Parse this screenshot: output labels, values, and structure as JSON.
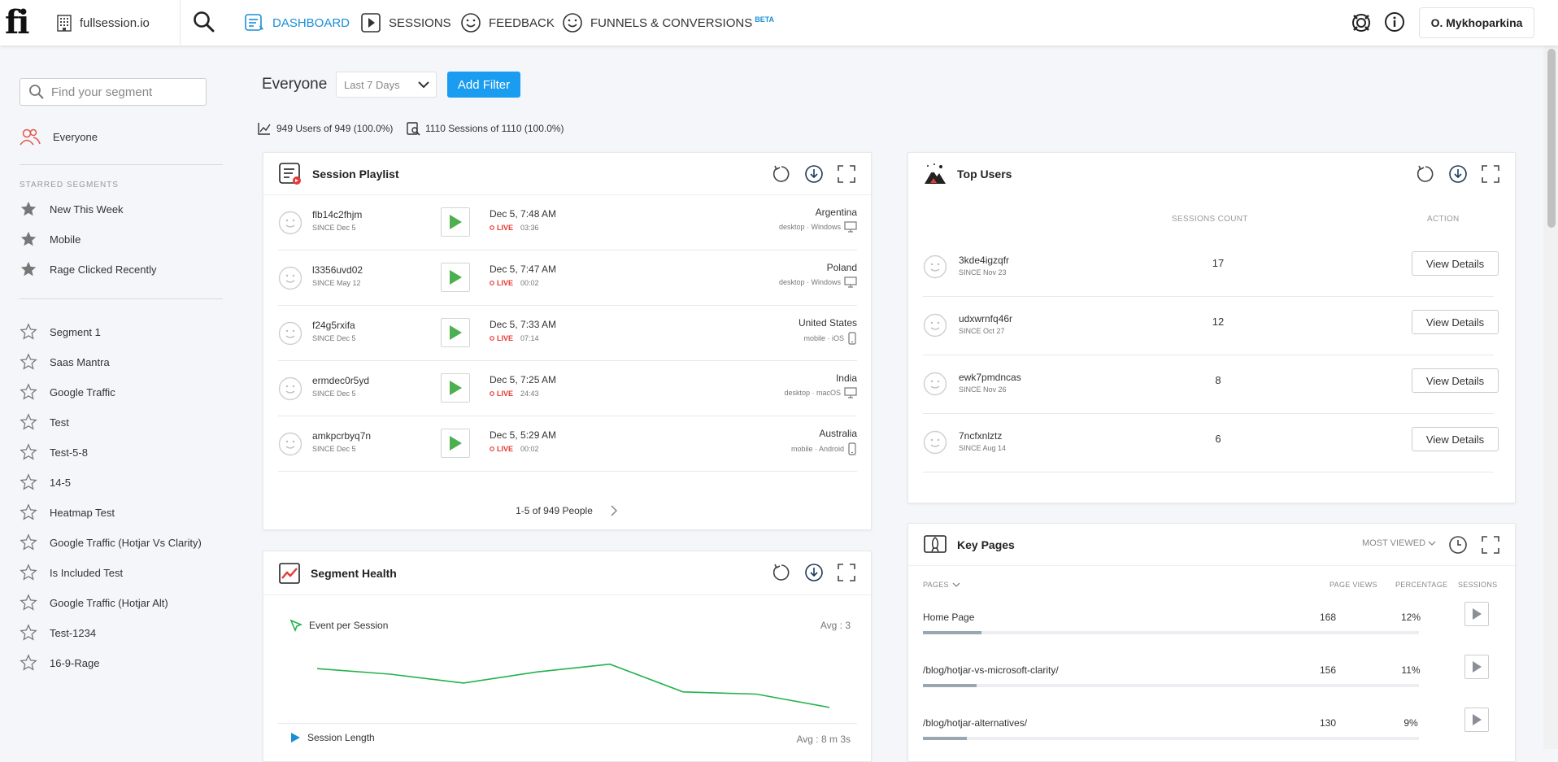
{
  "app": {
    "org_name": "fullsession.io",
    "user_name": "O. Mykhoparkina",
    "colors": {
      "accent": "#1a9cf0",
      "live": "#e53935",
      "play": "#4caf50",
      "health_line": "#22b24c"
    }
  },
  "nav": {
    "items": [
      {
        "label": "DASHBOARD",
        "icon": "dashboard-icon",
        "active": true
      },
      {
        "label": "SESSIONS",
        "icon": "play-square-icon"
      },
      {
        "label": "FEEDBACK",
        "icon": "smiley-icon"
      },
      {
        "label": "FUNNELS & CONVERSIONS",
        "icon": "smiley-icon"
      }
    ],
    "beta_badge": "BETA"
  },
  "sidebar": {
    "search_placeholder": "Find your segment",
    "everyone": "Everyone",
    "starred_heading": "STARRED SEGMENTS",
    "starred": [
      "New This Week",
      "Mobile",
      "Rage Clicked Recently"
    ],
    "segments": [
      "Segment 1",
      "Saas Mantra",
      "Google Traffic",
      "Test",
      "Test-5-8",
      "14-5",
      "Heatmap Test",
      "Google Traffic (Hotjar Vs Clarity)",
      "Is Included Test",
      "Google Traffic (Hotjar Alt)",
      "Test-1234",
      "16-9-Rage"
    ]
  },
  "toolbar": {
    "segment_title": "Everyone",
    "date_range": "Last 7 Days",
    "add_filter": "Add Filter",
    "users_stat": "949 Users of 949 (100.0%)",
    "sessions_stat": "1110 Sessions of 1110 (100.0%)"
  },
  "session_playlist": {
    "title": "Session Playlist",
    "rows": [
      {
        "name": "flb14c2fhjm",
        "since": "SINCE Dec 5",
        "time": "Dec 5, 7:48 AM",
        "live": "LIVE",
        "duration": "03:36",
        "country": "Argentina",
        "device": "desktop · Windows",
        "device_icon": "monitor-icon"
      },
      {
        "name": "l3356uvd02",
        "since": "SINCE May 12",
        "time": "Dec 5, 7:47 AM",
        "live": "LIVE",
        "duration": "00:02",
        "country": "Poland",
        "device": "desktop · Windows",
        "device_icon": "monitor-icon"
      },
      {
        "name": "f24g5rxifa",
        "since": "SINCE Dec 5",
        "time": "Dec 5, 7:33 AM",
        "live": "LIVE",
        "duration": "07:14",
        "country": "United States",
        "device": "mobile · iOS",
        "device_icon": "phone-icon"
      },
      {
        "name": "ermdec0r5yd",
        "since": "SINCE Dec 5",
        "time": "Dec 5, 7:25 AM",
        "live": "LIVE",
        "duration": "24:43",
        "country": "India",
        "device": "desktop · macOS",
        "device_icon": "monitor-icon"
      },
      {
        "name": "amkpcrbyq7n",
        "since": "SINCE Dec 5",
        "time": "Dec 5, 5:29 AM",
        "live": "LIVE",
        "duration": "00:02",
        "country": "Australia",
        "device": "mobile · Android",
        "device_icon": "phone-icon"
      }
    ],
    "pager": "1-5 of 949 People"
  },
  "top_users": {
    "title": "Top Users",
    "col_sessions": "SESSIONS COUNT",
    "col_action": "ACTION",
    "rows": [
      {
        "name": "3kde4igzqfr",
        "since": "SINCE Nov 23",
        "count": "17",
        "action": "View Details"
      },
      {
        "name": "udxwrnfq46r",
        "since": "SINCE Oct 27",
        "count": "12",
        "action": "View Details"
      },
      {
        "name": "ewk7pmdncas",
        "since": "SINCE Nov 26",
        "count": "8",
        "action": "View Details"
      },
      {
        "name": "7ncfxnlztz",
        "since": "SINCE Aug 14",
        "count": "6",
        "action": "View Details"
      }
    ]
  },
  "segment_health": {
    "title": "Segment Health",
    "metric1_label": "Event per Session",
    "metric1_avg": "Avg : 3",
    "metric1_series": [
      1.9,
      1.65,
      1.25,
      1.75,
      2.1,
      0.85,
      0.75,
      0.15
    ],
    "metric2_label": "Session Length",
    "metric2_avg": "Avg : 8 m 3s"
  },
  "key_pages": {
    "title": "Key Pages",
    "sort_label": "MOST VIEWED",
    "col_pages": "PAGES",
    "col_views": "PAGE VIEWS",
    "col_pct": "PERCENTAGE",
    "col_sessions": "SESSIONS",
    "rows": [
      {
        "page": "Home Page",
        "views": "168",
        "pct": "12%",
        "share": 0.12
      },
      {
        "page": "/blog/hotjar-vs-microsoft-clarity/",
        "views": "156",
        "pct": "11%",
        "share": 0.11
      },
      {
        "page": "/blog/hotjar-alternatives/",
        "views": "130",
        "pct": "9%",
        "share": 0.09
      }
    ]
  }
}
